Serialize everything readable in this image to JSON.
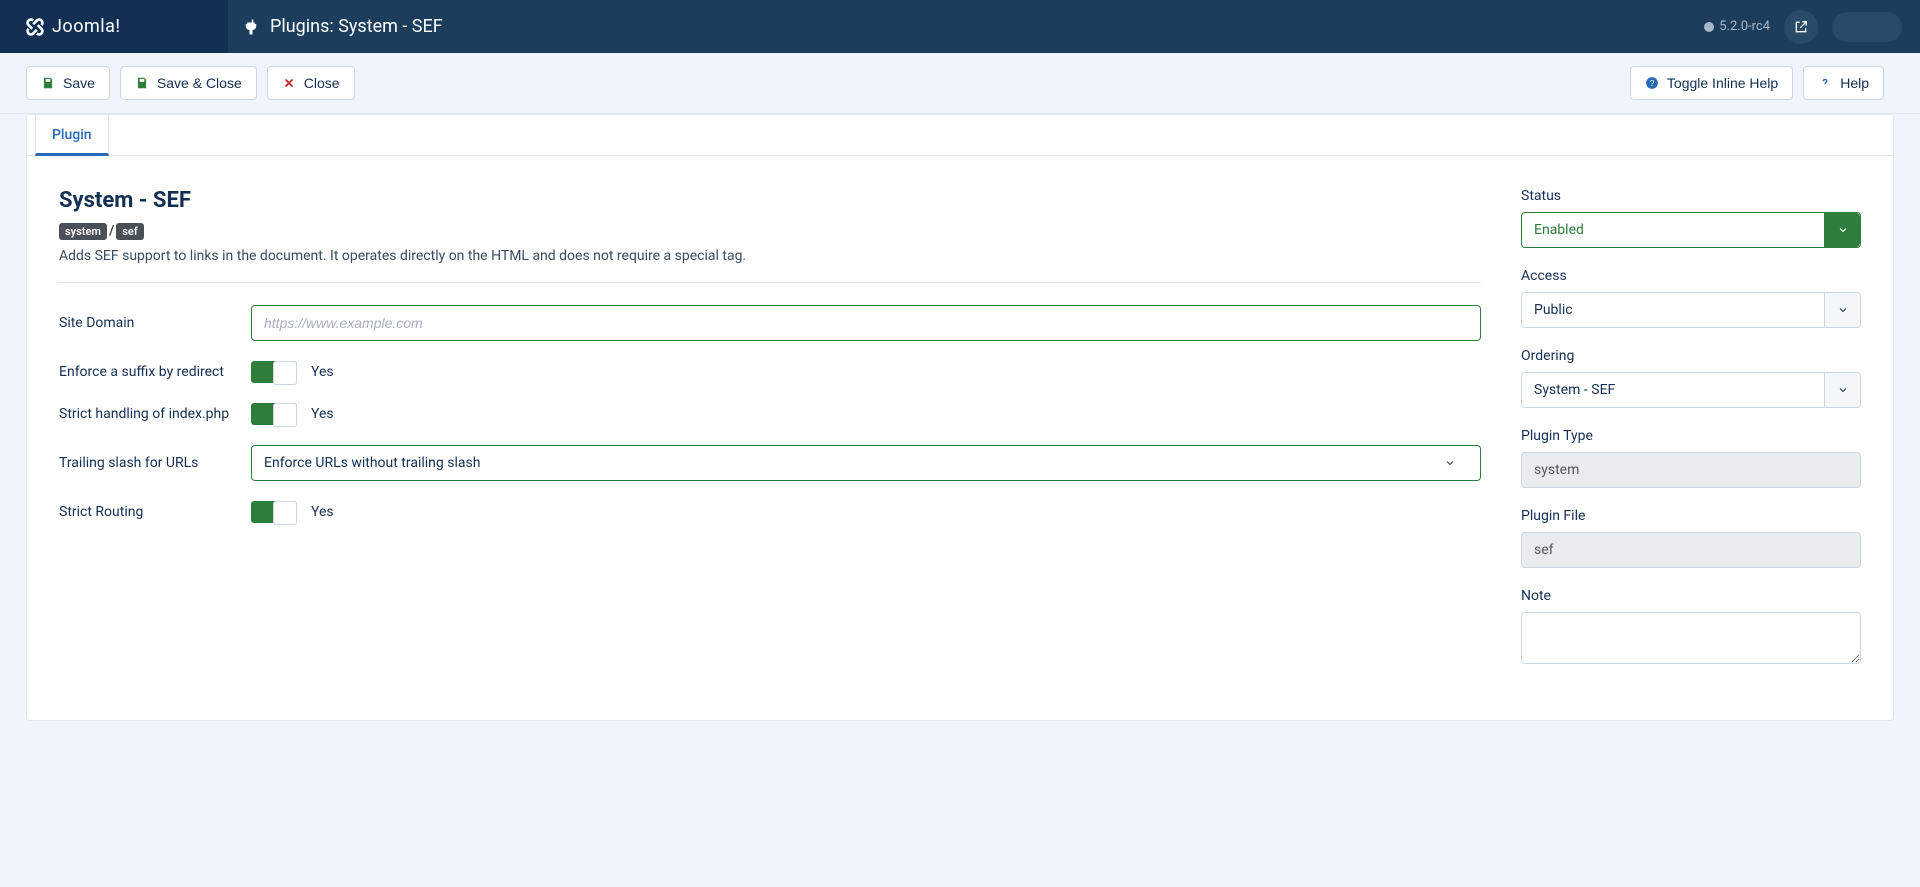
{
  "brand": "Joomla!",
  "pageTitle": "Plugins: System - SEF",
  "version": "5.2.0-rc4",
  "toolbar": {
    "save": "Save",
    "saveClose": "Save & Close",
    "close": "Close",
    "toggleHelp": "Toggle Inline Help",
    "help": "Help"
  },
  "tabs": {
    "plugin": "Plugin"
  },
  "plugin": {
    "title": "System - SEF",
    "badgeFolder": "system",
    "badgeElement": "sef",
    "description": "Adds SEF support to links in the document. It operates directly on the HTML and does not require a special tag."
  },
  "fields": {
    "siteDomain": {
      "label": "Site Domain",
      "placeholder": "https://www.example.com",
      "value": ""
    },
    "enforceSuffix": {
      "label": "Enforce a suffix by redirect",
      "value": "Yes"
    },
    "strictIndex": {
      "label": "Strict handling of index.php",
      "value": "Yes"
    },
    "trailingSlash": {
      "label": "Trailing slash for URLs",
      "value": "Enforce URLs without trailing slash"
    },
    "strictRouting": {
      "label": "Strict Routing",
      "value": "Yes"
    }
  },
  "side": {
    "status": {
      "label": "Status",
      "value": "Enabled"
    },
    "access": {
      "label": "Access",
      "value": "Public"
    },
    "ordering": {
      "label": "Ordering",
      "value": "System - SEF"
    },
    "pluginType": {
      "label": "Plugin Type",
      "value": "system"
    },
    "pluginFile": {
      "label": "Plugin File",
      "value": "sef"
    },
    "note": {
      "label": "Note",
      "value": ""
    }
  }
}
